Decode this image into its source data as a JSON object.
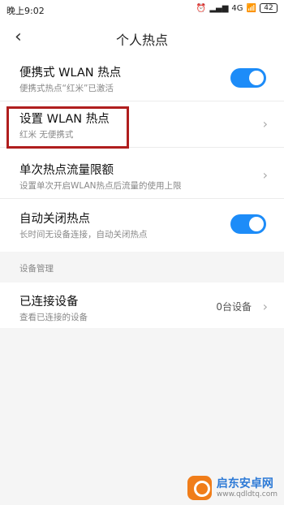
{
  "status_bar": {
    "time": "晚上9:02",
    "network": "4G",
    "battery": "42",
    "icons": [
      "alarm-icon",
      "signal-icon",
      "wifi-icon",
      "battery-icon"
    ]
  },
  "header": {
    "title": "个人热点",
    "back_icon": "back-arrow-icon"
  },
  "settings": [
    {
      "label": "便携式 WLAN 热点",
      "sub": "便携式热点“红米”已激活",
      "control": "toggle",
      "on": true
    },
    {
      "label": "设置 WLAN 热点",
      "sub": "红米 无便携式",
      "control": "chevron"
    },
    {
      "label": "单次热点流量限额",
      "sub": "设置单次开启WLAN热点后流量的使用上限",
      "control": "chevron"
    },
    {
      "label": "自动关闭热点",
      "sub": "长时间无设备连接，自动关闭热点",
      "control": "toggle",
      "on": true
    }
  ],
  "device_section": {
    "title": "设备管理",
    "item": {
      "label": "已连接设备",
      "sub": "查看已连接的设备",
      "value": "0台设备"
    }
  },
  "watermark": {
    "name": "启东安卓网",
    "url": "www.qdldtq.com"
  },
  "colors": {
    "accent": "#1d8cf8",
    "highlight": "#b01e1e"
  }
}
